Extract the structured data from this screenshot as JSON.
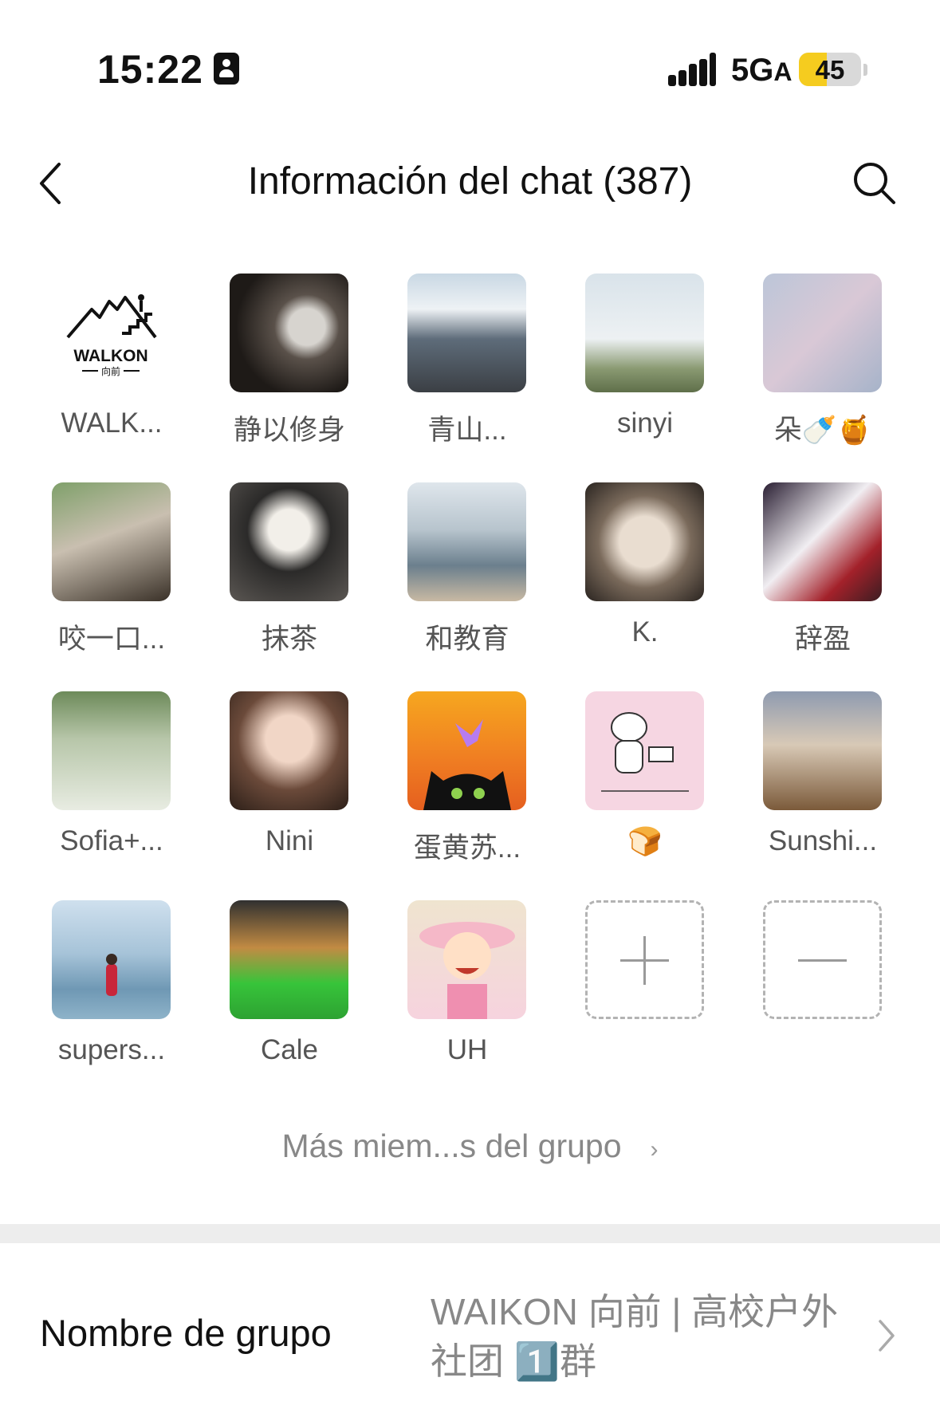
{
  "status_bar": {
    "time": "15:22",
    "network": "5G",
    "network_suffix": "A",
    "battery": "45",
    "battery_level": 0.45
  },
  "nav": {
    "title": "Información del chat (387)"
  },
  "members": [
    {
      "name": "WALK..."
    },
    {
      "name": "静以修身"
    },
    {
      "name": "青山..."
    },
    {
      "name": "sinyi"
    },
    {
      "name": "朵🍼🍯"
    },
    {
      "name": "咬一口..."
    },
    {
      "name": "抹茶"
    },
    {
      "name": "和教育"
    },
    {
      "name": "K."
    },
    {
      "name": "辞盈"
    },
    {
      "name": "Sofia+..."
    },
    {
      "name": "Nini"
    },
    {
      "name": "蛋黄苏..."
    },
    {
      "name": "🍞"
    },
    {
      "name": "Sunshi..."
    },
    {
      "name": "supers..."
    },
    {
      "name": "Cale"
    },
    {
      "name": "UH"
    }
  ],
  "walkon_logo": {
    "brand": "WALKON",
    "sub": "向前"
  },
  "more_members": "Más miem...s del grupo",
  "group_name": {
    "label": "Nombre de grupo",
    "value": "WAIKON 向前 | 高校户外社团 1️⃣群"
  },
  "icons": {
    "back": "chevron-left-icon",
    "search": "search-icon",
    "add": "plus-icon",
    "remove": "minus-icon"
  }
}
